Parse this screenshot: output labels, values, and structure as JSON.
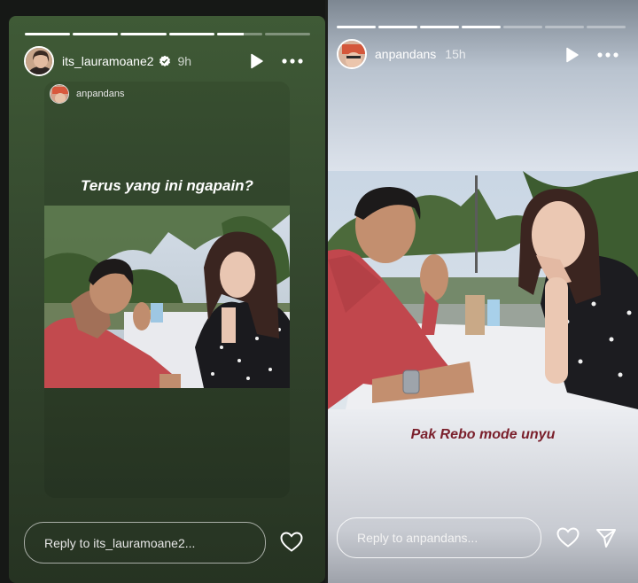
{
  "left_story": {
    "progress_segments": [
      1,
      1,
      1,
      1,
      0.6,
      0
    ],
    "username": "its_lauramoane2",
    "verified": true,
    "time": "9h",
    "play_icon": "play-icon",
    "more_icon": "more-options-icon",
    "reshared_from": "anpandans",
    "caption": "Terus yang ini ngapain?",
    "reply_placeholder": "Reply to its_lauramoane2...",
    "like_icon": "heart-icon",
    "bg_color": "#3a5232"
  },
  "right_story": {
    "progress_segments": [
      1,
      1,
      1,
      1,
      0,
      0,
      0
    ],
    "username": "anpandans",
    "time": "15h",
    "play_icon": "play-icon",
    "more_icon": "more-options-icon",
    "caption": "Pak Rebo mode unyu",
    "caption_color": "#7a1f2b",
    "reply_placeholder": "Reply to anpandans...",
    "like_icon": "heart-icon",
    "send_icon": "send-icon"
  }
}
